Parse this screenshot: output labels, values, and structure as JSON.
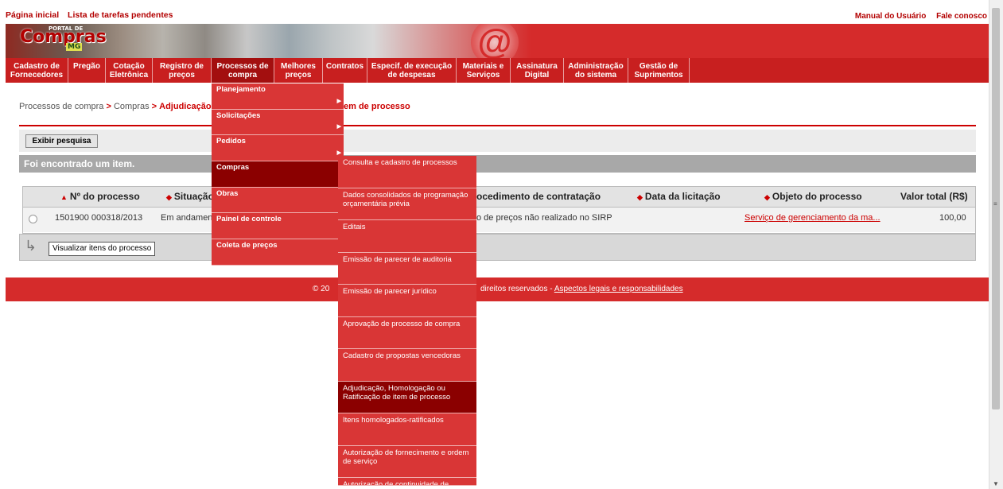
{
  "top_links_left": [
    "Página inicial",
    "Lista de tarefas pendentes"
  ],
  "top_links_right": [
    "Manual do Usuário",
    "Fale conosco"
  ],
  "logo": {
    "text": "Compras",
    "small": "PORTAL DE",
    "state": "MG"
  },
  "nav": [
    {
      "label": "Cadastro de Fornecedores"
    },
    {
      "label": "Pregão"
    },
    {
      "label": "Cotação Eletrônica"
    },
    {
      "label": "Registro de preços"
    },
    {
      "label": "Processos de compra"
    },
    {
      "label": "Melhores preços"
    },
    {
      "label": "Contratos"
    },
    {
      "label": "Especif. de execução de despesas"
    },
    {
      "label": "Materiais e Serviços"
    },
    {
      "label": "Assinatura Digital"
    },
    {
      "label": "Administração do sistema"
    },
    {
      "label": "Gestão de Suprimentos"
    }
  ],
  "breadcrumb": {
    "part1": "Processos de compra",
    "part2": "Compras",
    "current_start": "Adjudicação, ",
    "current_end": "em de processo"
  },
  "search_button": "Exibir pesquisa",
  "found_text": "Foi encontrado um item.",
  "table": {
    "headers": [
      "Nº do processo",
      "Situação",
      "ocedimento de contratação",
      "Data da licitação",
      "Objeto do processo",
      "Valor total (R$)"
    ],
    "row": {
      "numero": "1501900 000318/2013",
      "situacao": "Em andamen",
      "procedimento": "o de preços não realizado no SIRP",
      "data": "",
      "objeto": "Serviço de gerenciamento da ma...",
      "valor": "100,00"
    }
  },
  "action_button": "Visualizar itens do processo",
  "footer": {
    "left": "© 20",
    "right": "direitos reservados - ",
    "link": "Aspectos legais e responsabilidades"
  },
  "menu_level1": [
    {
      "label": "Planejamento",
      "has_sub": true
    },
    {
      "label": "Solicitações",
      "has_sub": true
    },
    {
      "label": "Pedidos",
      "has_sub": true
    },
    {
      "label": "Compras",
      "has_sub": false
    },
    {
      "label": "Obras",
      "has_sub": false
    },
    {
      "label": "Painel de controle",
      "has_sub": false
    },
    {
      "label": "Coleta de preços",
      "has_sub": false
    }
  ],
  "menu_level2": [
    "Consulta e cadastro de processos",
    "Dados consolidados de programação orçamentária prévia",
    "Editais",
    "Emissão de parecer de auditoria",
    "Emissão de parecer jurídico",
    "Aprovação de processo de compra",
    "Cadastro de propostas vencedoras",
    "Adjudicação, Homologação ou Ratificação de item de processo",
    "Itens homologados-ratificados",
    "Autorização de fornecimento e ordem de serviço",
    "Autorização de continuidade de"
  ],
  "colors": {
    "brand_red": "#d52b2b",
    "dark_red": "#8b0000"
  }
}
